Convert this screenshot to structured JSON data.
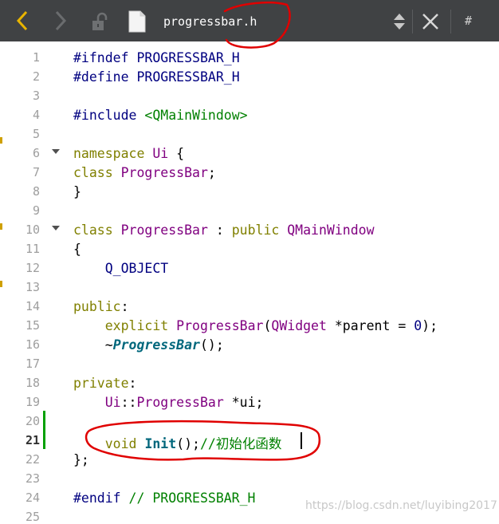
{
  "toolbar": {
    "back_icon": "chevron-left-icon",
    "forward_icon": "chevron-right-icon",
    "lock_icon": "lock-icon",
    "file_icon": "file-icon",
    "filename": "progressbar.h",
    "close_icon": "close-icon",
    "split_label": "#",
    "accent_color": "#e8b400"
  },
  "editor": {
    "current_line": 21,
    "line_numbers": [
      "1",
      "2",
      "3",
      "4",
      "5",
      "6",
      "7",
      "8",
      "9",
      "10",
      "11",
      "12",
      "13",
      "14",
      "15",
      "16",
      "17",
      "18",
      "19",
      "20",
      "21",
      "22",
      "23",
      "24",
      "25"
    ],
    "tokens": {
      "l1_dir": "#ifndef",
      "l1_name": "PROGRESSBAR_H",
      "l2_dir": "#define",
      "l2_name": "PROGRESSBAR_H",
      "l4_dir": "#include",
      "l4_file": "<QMainWindow>",
      "l6_kw": "namespace",
      "l6_ns": "Ui",
      "l6_brace": " {",
      "l7_kw": "class",
      "l7_cls": "ProgressBar",
      "l7_semi": ";",
      "l8_brace": "}",
      "l10_kw": "class",
      "l10_cls": "ProgressBar",
      "l10_colon": " : ",
      "l10_pub": "public",
      "l10_base": "QMainWindow",
      "l11_brace": "{",
      "l12_macro": "Q_OBJECT",
      "l14_kw": "public",
      "l14_colon": ":",
      "l15_kw": "explicit",
      "l15_cls": "ProgressBar",
      "l15_paren": "(",
      "l15_type": "QWidget",
      "l15_rest": " *parent = ",
      "l15_num": "0",
      "l15_end": ");",
      "l16_tilde": "~",
      "l16_dtor": "ProgressBar",
      "l16_end": "();",
      "l18_kw": "private",
      "l18_colon": ":",
      "l19_ns": "Ui",
      "l19_sep": "::",
      "l19_cls": "ProgressBar",
      "l19_rest": " *ui;",
      "l21_kw": "void",
      "l21_fn": "Init",
      "l21_rest": "();",
      "l21_cmt": "//初始化函数",
      "l22_end": "};",
      "l24_dir": "#endif",
      "l24_cmt": "// PROGRESSBAR_H"
    }
  },
  "watermark": "https://blog.csdn.net/luyibing2017",
  "annotation_color": "#e00000"
}
